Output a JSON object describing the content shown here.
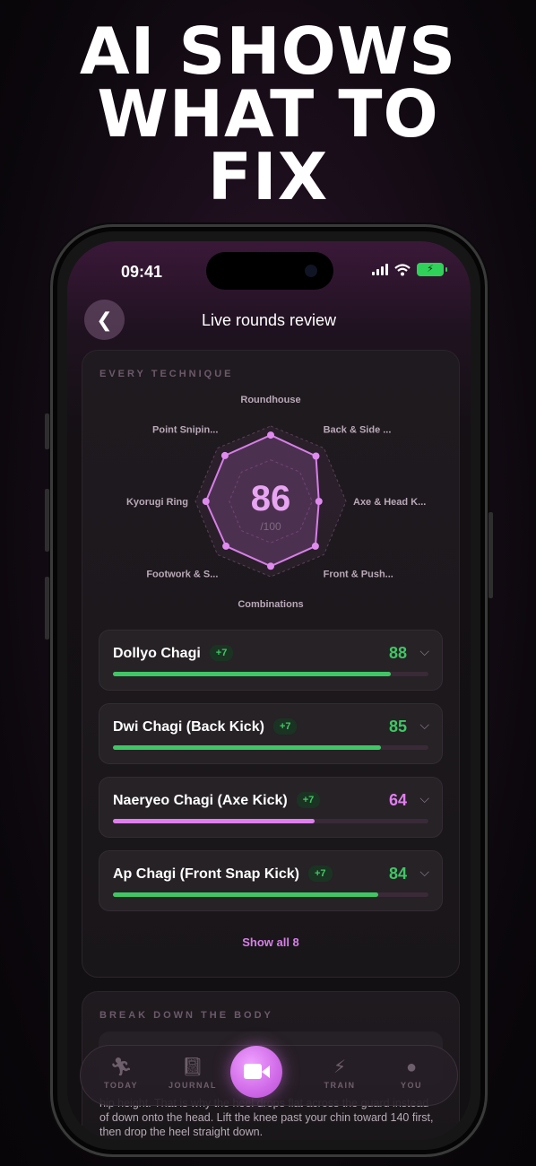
{
  "headline": [
    "AI SHOWS",
    "WHAT TO",
    "FIX"
  ],
  "status_bar": {
    "time": "09:41"
  },
  "nav": {
    "title": "Live rounds review"
  },
  "technique_card": {
    "label": "EVERY TECHNIQUE",
    "overall_score": "86",
    "overall_max": "/100",
    "radar_axes": [
      "Roundhouse",
      "Back & Side ...",
      "Axe & Head K...",
      "Front & Push...",
      "Combinations",
      "Footwork & S...",
      "Kyorugi Ring",
      "Point Snipin..."
    ],
    "radar_values": [
      88,
      85,
      64,
      84,
      86,
      84,
      86,
      86
    ],
    "rows": [
      {
        "name": "Dollyo Chagi",
        "delta": "+7",
        "score": "88",
        "progress": 0.88,
        "color": "#3ec764"
      },
      {
        "name": "Dwi Chagi (Back Kick)",
        "delta": "+7",
        "score": "85",
        "progress": 0.85,
        "color": "#3ec764"
      },
      {
        "name": "Naeryeo Chagi (Axe Kick)",
        "delta": "+7",
        "score": "64",
        "progress": 0.64,
        "color": "#e07ef0"
      },
      {
        "name": "Ap Chagi (Front Snap Kick)",
        "delta": "+7",
        "score": "84",
        "progress": 0.84,
        "color": "#3ec764"
      }
    ],
    "show_all": "Show all 8"
  },
  "body_card": {
    "label": "BREAK DOWN THE BODY",
    "text": "hip height. That is why the heel drops flat across the guard instead of down onto the head. Lift the knee past your chin toward 140 first, then drop the heel straight down."
  },
  "tabbar": {
    "items": [
      {
        "label": "TODAY",
        "icon": "runner-icon"
      },
      {
        "label": "JOURNAL",
        "icon": "notebook-icon"
      },
      {
        "label": "TRAIN",
        "icon": "lightning-icon"
      },
      {
        "label": "YOU",
        "icon": "profile-icon"
      }
    ],
    "center_icon": "video-camera-icon"
  },
  "colors": {
    "accent": "#d77fe8",
    "good": "#3ec764"
  }
}
